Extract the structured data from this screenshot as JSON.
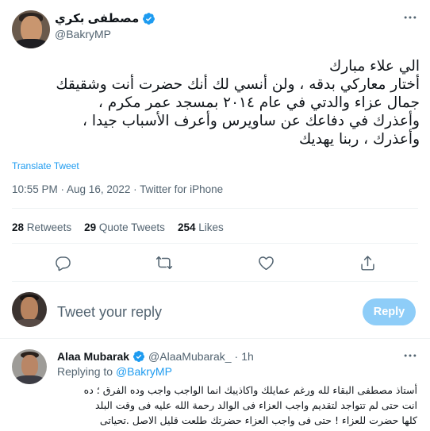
{
  "tweet": {
    "author": {
      "name": "مصطفى بكري",
      "handle": "@BakryMP",
      "verified": true
    },
    "text_lines": [
      "الي علاء مبارك",
      "أختار معاركي بدقه ، ولن أنسي لك أنك حضرت أنت وشقيقك",
      "جمال عزاء والدتي في عام ٢٠١٤ بمسجد عمر مكرم ،",
      "وأعذرك في دفاعك عن ساويرس وأعرف الأسباب جيدا ،",
      "وأعذرك ، ربنا يهديك"
    ],
    "translate_label": "Translate Tweet",
    "timestamp": "10:55 PM · Aug 16, 2022 · Twitter for iPhone",
    "stats": {
      "retweets_count": "28",
      "retweets_label": "Retweets",
      "quotes_count": "29",
      "quotes_label": "Quote Tweets",
      "likes_count": "254",
      "likes_label": "Likes"
    },
    "actions": [
      "reply-icon",
      "retweet-icon",
      "like-icon",
      "share-icon"
    ]
  },
  "compose": {
    "placeholder": "Tweet your reply",
    "reply_button_label": "Reply"
  },
  "reply": {
    "author_name": "Alaa Mubarak",
    "verified": true,
    "handle": "@AlaaMubarak_",
    "separator": "·",
    "time": "1h",
    "replying_to_label": "Replying to",
    "replying_to_handle": "@BakryMP",
    "text_lines": [
      "أستاذ مصطفى  البقاء لله ورغم عمايلك واكاذيبك انما الواجب واجب وده الفرق ؛ ده",
      "انت حتى لم تتواجد لتقديم واجب العزاء فى الوالد رحمة الله عليه فى وقت البلد",
      "كلها حضرت للعزاء !  حتى فى واجب العزاء حضرتك طلعت قليل الاصل .تحياتى"
    ]
  },
  "colors": {
    "accent": "#1d9bf0",
    "reply_button_disabled": "#8ecdf8",
    "muted_text": "#536471",
    "divider": "#eff3f4"
  }
}
